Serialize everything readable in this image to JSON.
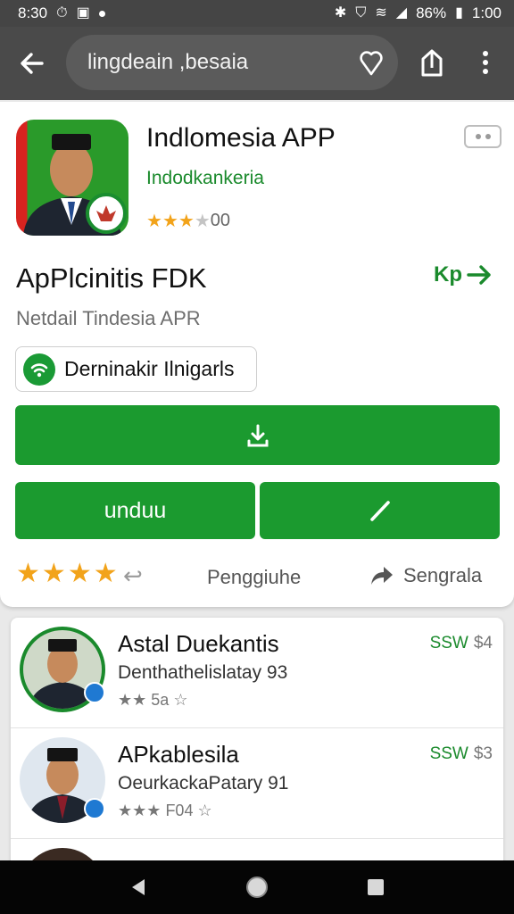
{
  "status_bar": {
    "time": "8:30",
    "battery": "86%",
    "clock_right": "1:00"
  },
  "search": {
    "query": "lingdeain ,besaia"
  },
  "app": {
    "title": "Indlomesia APP",
    "developer": "Indodkankeria",
    "rating_count": "00",
    "stars_on": 3
  },
  "section": {
    "title": "ApPlcinitis FDK",
    "link": "Kp",
    "subtitle": "Netdail Tindesia APR"
  },
  "tag": {
    "label": "Derninakir Ilnigarls"
  },
  "buttons": {
    "unduh": "unduu"
  },
  "bottom": {
    "pengu": "Penggiuhe",
    "sengra": "Sengrala"
  },
  "list": [
    {
      "title": "Astal Duekantis",
      "sub": "Denthathelislatay 93",
      "meta": "5a",
      "price": "SSW",
      "price2": "$4"
    },
    {
      "title": "APkablesila",
      "sub": "OeurkackaPatary 91",
      "meta": "F04",
      "price": "SSW",
      "price2": "$3"
    }
  ],
  "colors": {
    "accent": "#1b9a2f",
    "star": "#f2a31a"
  }
}
